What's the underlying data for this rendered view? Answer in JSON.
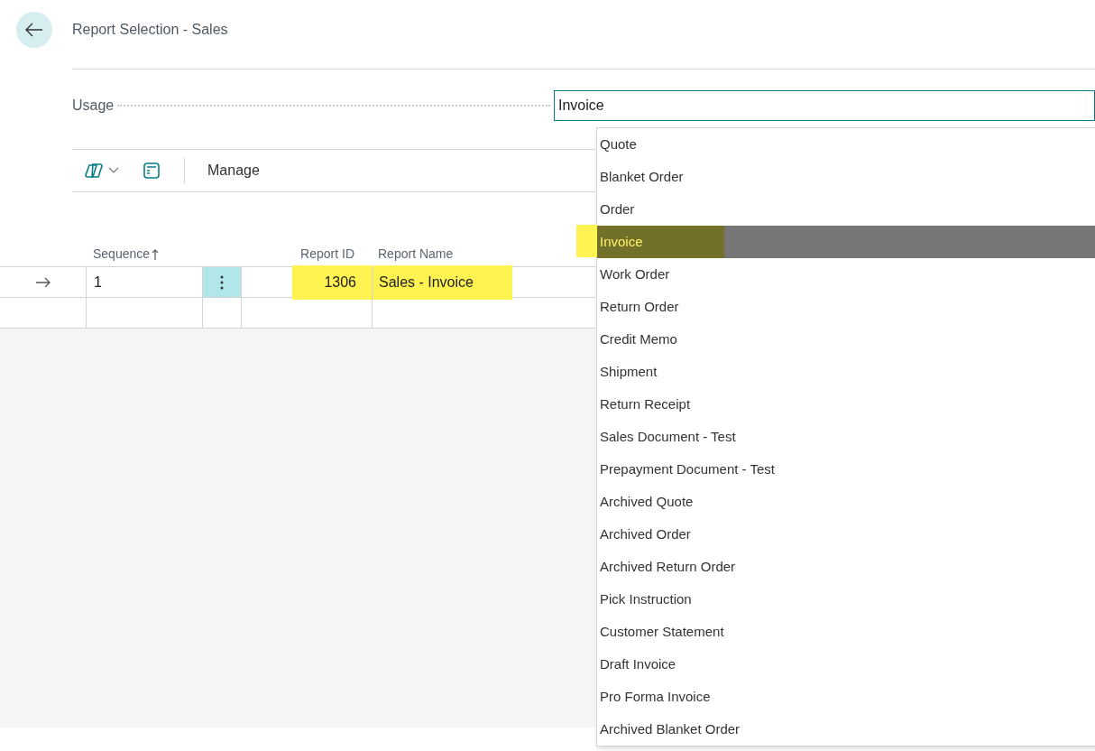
{
  "page": {
    "title": "Report Selection - Sales"
  },
  "usage": {
    "label": "Usage",
    "value": "Invoice"
  },
  "toolbar": {
    "actions": [
      "Manage"
    ]
  },
  "table": {
    "columns": [
      {
        "label": "Sequence",
        "sorted": true
      },
      {
        "label": "Report ID",
        "sorted": false
      },
      {
        "label": "Report Name",
        "sorted": false
      }
    ],
    "rows": [
      {
        "current": true,
        "sequence": "1",
        "report_id": "1306",
        "report_name": "Sales - Invoice",
        "highlighted": true
      }
    ]
  },
  "dropdown": {
    "options": [
      {
        "label": "Quote",
        "selected": false
      },
      {
        "label": "Blanket Order",
        "selected": false
      },
      {
        "label": "Order",
        "selected": false
      },
      {
        "label": "Invoice",
        "selected": true
      },
      {
        "label": "Work Order",
        "selected": false
      },
      {
        "label": "Return Order",
        "selected": false
      },
      {
        "label": "Credit Memo",
        "selected": false
      },
      {
        "label": "Shipment",
        "selected": false
      },
      {
        "label": "Return Receipt",
        "selected": false
      },
      {
        "label": "Sales Document - Test",
        "selected": false
      },
      {
        "label": "Prepayment Document - Test",
        "selected": false
      },
      {
        "label": "Archived Quote",
        "selected": false
      },
      {
        "label": "Archived Order",
        "selected": false
      },
      {
        "label": "Archived Return Order",
        "selected": false
      },
      {
        "label": "Pick Instruction",
        "selected": false
      },
      {
        "label": "Customer Statement",
        "selected": false
      },
      {
        "label": "Draft Invoice",
        "selected": false
      },
      {
        "label": "Pro Forma Invoice",
        "selected": false
      },
      {
        "label": "Archived Blanket Order",
        "selected": false
      }
    ]
  }
}
